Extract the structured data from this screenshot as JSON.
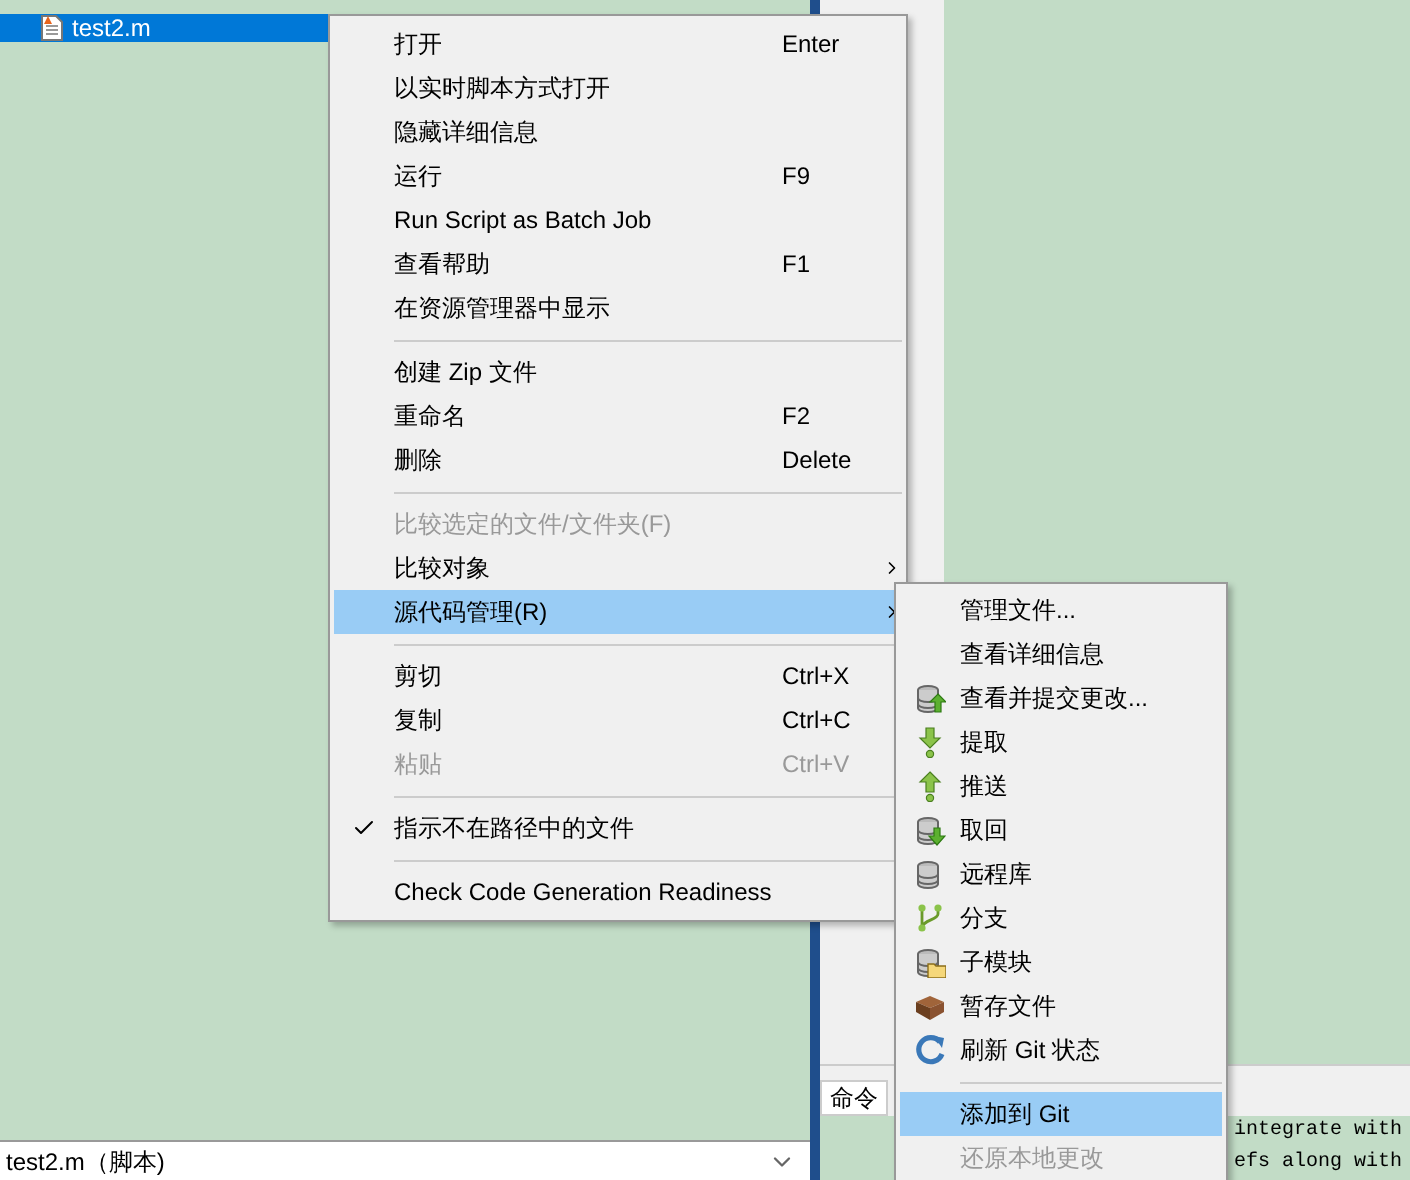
{
  "file_list": {
    "rows": [
      {
        "name": "test2.m",
        "selected": true
      }
    ]
  },
  "status_bar": {
    "text": "test2.m（脚本)"
  },
  "command_window": {
    "tab": "命令",
    "lines": [
      "integrate with",
      "efs along with"
    ]
  },
  "context_menu": {
    "items": [
      {
        "kind": "item",
        "label": "打开",
        "shortcut": "Enter",
        "disabled": false,
        "checked": false,
        "submenu": false,
        "selected": false
      },
      {
        "kind": "item",
        "label": "以实时脚本方式打开",
        "disabled": false,
        "checked": false,
        "submenu": false,
        "selected": false
      },
      {
        "kind": "item",
        "label": "隐藏详细信息",
        "disabled": false,
        "checked": false,
        "submenu": false,
        "selected": false
      },
      {
        "kind": "item",
        "label": "运行",
        "shortcut": "F9",
        "disabled": false,
        "checked": false,
        "submenu": false,
        "selected": false
      },
      {
        "kind": "item",
        "label": "Run Script as Batch Job",
        "disabled": false,
        "checked": false,
        "submenu": false,
        "selected": false
      },
      {
        "kind": "item",
        "label": "查看帮助",
        "shortcut": "F1",
        "disabled": false,
        "checked": false,
        "submenu": false,
        "selected": false
      },
      {
        "kind": "item",
        "label": "在资源管理器中显示",
        "disabled": false,
        "checked": false,
        "submenu": false,
        "selected": false
      },
      {
        "kind": "separator"
      },
      {
        "kind": "item",
        "label": "创建 Zip 文件",
        "disabled": false,
        "checked": false,
        "submenu": false,
        "selected": false
      },
      {
        "kind": "item",
        "label": "重命名",
        "shortcut": "F2",
        "disabled": false,
        "checked": false,
        "submenu": false,
        "selected": false
      },
      {
        "kind": "item",
        "label": "删除",
        "shortcut": "Delete",
        "disabled": false,
        "checked": false,
        "submenu": false,
        "selected": false
      },
      {
        "kind": "separator"
      },
      {
        "kind": "item",
        "label": "比较选定的文件/文件夹(F)",
        "disabled": true,
        "checked": false,
        "submenu": false,
        "selected": false
      },
      {
        "kind": "item",
        "label": "比较对象",
        "disabled": false,
        "checked": false,
        "submenu": true,
        "selected": false
      },
      {
        "kind": "item",
        "label": "源代码管理(R)",
        "disabled": false,
        "checked": false,
        "submenu": true,
        "selected": true
      },
      {
        "kind": "separator"
      },
      {
        "kind": "item",
        "label": "剪切",
        "shortcut": "Ctrl+X",
        "disabled": false,
        "checked": false,
        "submenu": false,
        "selected": false
      },
      {
        "kind": "item",
        "label": "复制",
        "shortcut": "Ctrl+C",
        "disabled": false,
        "checked": false,
        "submenu": false,
        "selected": false
      },
      {
        "kind": "item",
        "label": "粘贴",
        "shortcut": "Ctrl+V",
        "disabled": true,
        "checked": false,
        "submenu": false,
        "selected": false
      },
      {
        "kind": "separator"
      },
      {
        "kind": "item",
        "label": "指示不在路径中的文件",
        "disabled": false,
        "checked": true,
        "submenu": false,
        "selected": false
      },
      {
        "kind": "separator"
      },
      {
        "kind": "item",
        "label": "Check Code Generation Readiness",
        "disabled": false,
        "checked": false,
        "submenu": false,
        "selected": false
      }
    ]
  },
  "submenu": {
    "items": [
      {
        "kind": "item",
        "label": "管理文件...",
        "disabled": false,
        "selected": false
      },
      {
        "kind": "item",
        "label": "查看详细信息",
        "disabled": false,
        "selected": false
      },
      {
        "kind": "item",
        "label": "查看并提交更改...",
        "disabled": false,
        "selected": false
      },
      {
        "kind": "item",
        "label": "提取",
        "disabled": false,
        "selected": false
      },
      {
        "kind": "item",
        "label": "推送",
        "disabled": false,
        "selected": false
      },
      {
        "kind": "item",
        "label": "取回",
        "disabled": false,
        "selected": false
      },
      {
        "kind": "item",
        "label": "远程库",
        "disabled": false,
        "selected": false
      },
      {
        "kind": "item",
        "label": "分支",
        "disabled": false,
        "selected": false
      },
      {
        "kind": "item",
        "label": "子模块",
        "disabled": false,
        "selected": false
      },
      {
        "kind": "item",
        "label": "暂存文件",
        "disabled": false,
        "selected": false
      },
      {
        "kind": "item",
        "label": "刷新 Git 状态",
        "disabled": false,
        "selected": false
      },
      {
        "kind": "separator"
      },
      {
        "kind": "item",
        "label": "添加到 Git",
        "disabled": false,
        "selected": true
      },
      {
        "kind": "item",
        "label": "还原本地更改",
        "disabled": true,
        "selected": false
      }
    ]
  }
}
